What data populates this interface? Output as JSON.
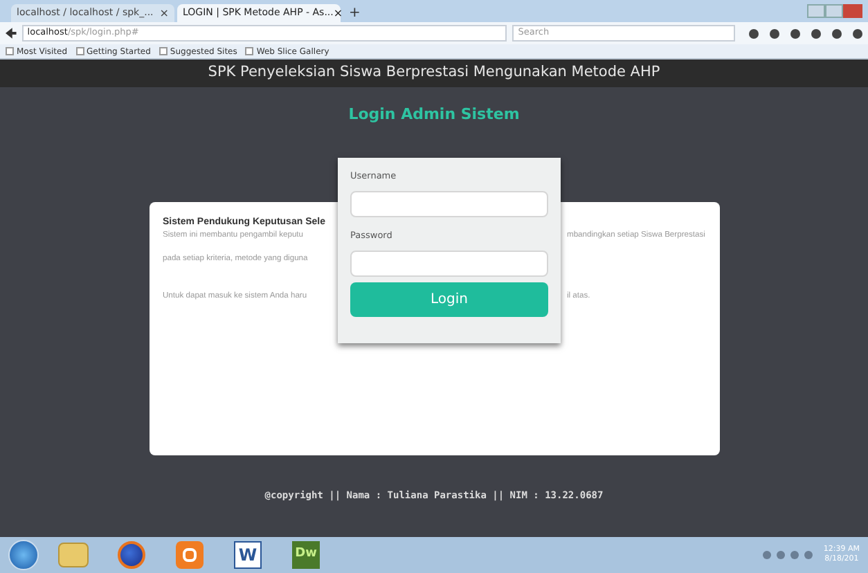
{
  "browser": {
    "tabs": [
      {
        "label": "localhost / localhost / spk_...",
        "selected": false,
        "close": "×"
      },
      {
        "label": "LOGIN | SPK Metode AHP - As...",
        "selected": true,
        "close": "×"
      }
    ],
    "new_tab": "+",
    "url": {
      "host": "localhost",
      "path": "/spk/login.php#"
    },
    "search": {
      "placeholder": "Search"
    },
    "bookmarks": [
      "Most Visited",
      "Getting Started",
      "Suggested Sites",
      "Web Slice Gallery"
    ]
  },
  "header": {
    "title": "SPK Penyeleksian Siswa Berprestasi Mengunakan Metode AHP"
  },
  "login_heading": "Login Admin Sistem",
  "card": {
    "title": "Sistem Pendukung Keputusan Sele",
    "lines_left": [
      "Sistem ini membantu pengambil keputu",
      "pada setiap kriteria, metode yang diguna"
    ],
    "line_right": "mbandingkan setiap Siswa Berprestasi",
    "note_left": "Untuk dapat masuk ke sistem Anda haru",
    "note_right": "il atas."
  },
  "login_form": {
    "username_label": "Username",
    "password_label": "Password",
    "button": "Login"
  },
  "footer": "@copyright || Nama : Tuliana Parastika || NIM : 13.22.0687",
  "taskbar": {
    "apps": [
      {
        "kind": "folder"
      },
      {
        "kind": "browser"
      },
      {
        "kind": "xampp"
      },
      {
        "kind": "word",
        "glyph": "W"
      },
      {
        "kind": "dw",
        "glyph": "Dw"
      }
    ],
    "time": "12:39 AM",
    "date": "8/18/201"
  }
}
